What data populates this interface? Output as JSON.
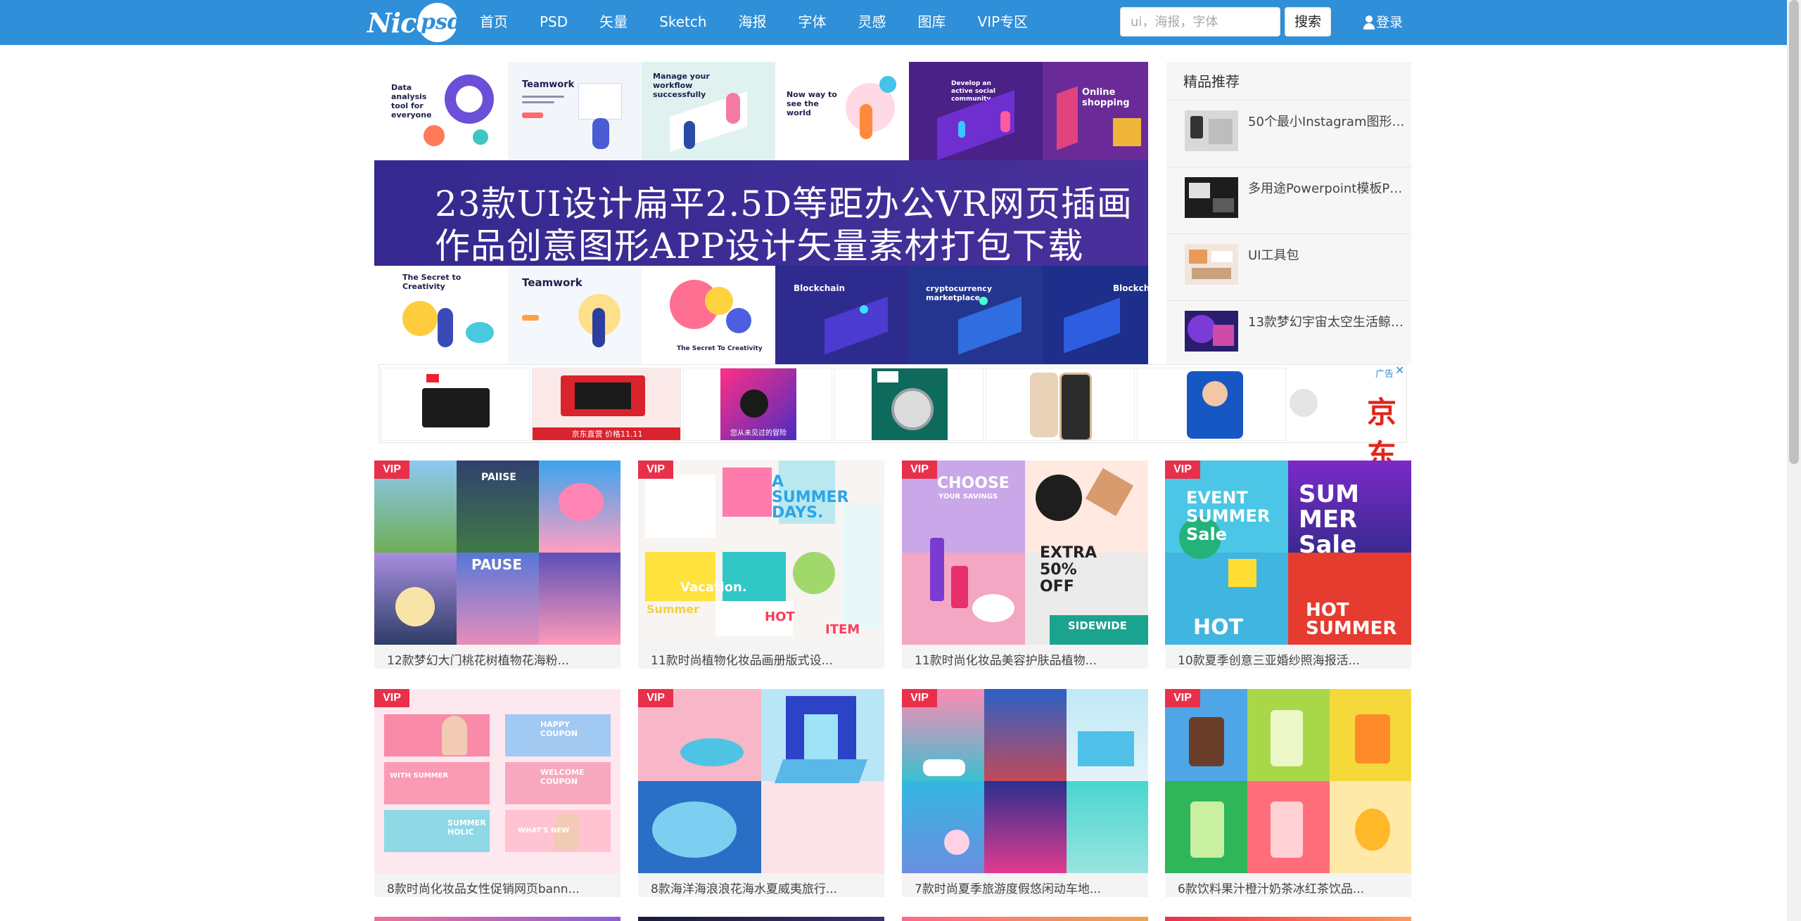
{
  "header": {
    "logo_nice": "Nice",
    "logo_psd": "psd",
    "nav": [
      "首页",
      "PSD",
      "矢量",
      "Sketch",
      "海报",
      "字体",
      "灵感",
      "图库",
      "VIP专区"
    ],
    "search_placeholder": "ui，海报，字体",
    "search_button": "搜索",
    "login": "登录"
  },
  "banner": {
    "line1": "23款UI设计扁平2.5D等距办公VR网页插画",
    "line2": "作品创意图形APP设计矢量素材打包下载",
    "tiles_top": [
      "Data analysis tool for everyone",
      "Teamwork",
      "Manage your workflow successfully",
      "Now way to see the world",
      "Develop an active social community",
      "Online shopping"
    ],
    "tiles_bottom": [
      "The Secret to Creativity",
      "Teamwork",
      "The Secret To Creativity",
      "Blockchain",
      "cryptocurrency marketplace",
      "Blockch"
    ]
  },
  "sidebar": {
    "title": "精品推荐",
    "items": [
      {
        "title": "50个最小Instagram图形，..."
      },
      {
        "title": "多用途Powerpoint模板PP..."
      },
      {
        "title": "UI工具包"
      },
      {
        "title": "13款梦幻宇宙太空生活鲸鱼..."
      }
    ]
  },
  "ad": {
    "badge": "广告",
    "close": "✕",
    "brand": "京东",
    "ad2_caption": "京东直营 价格11.11",
    "ad3_caption": "您从未见过的冒险"
  },
  "cards": [
    {
      "vip": "VIP",
      "title": "12款梦幻大门桃花树植物花海粉...",
      "texts": [
        "PAIISE",
        "PAUSE"
      ]
    },
    {
      "vip": "VIP",
      "title": "11款时尚植物化妆品画册版式设...",
      "texts": [
        "A SUMMER DAYS.",
        "Vacation.",
        "Summer",
        "HOT",
        "ITEM"
      ]
    },
    {
      "vip": "VIP",
      "title": "11款时尚化妆品美容护肤品植物...",
      "texts": [
        "CHOOSE",
        "YOUR SAVINGS",
        "EXTRA 50% OFF",
        "SIDEWIDE"
      ]
    },
    {
      "vip": "VIP",
      "title": "10款夏季创意三亚婚纱照海报活...",
      "texts": [
        "EVENT SUMMER Sale",
        "SUM MER Sale",
        "HOT",
        "HOT SUMMER"
      ]
    },
    {
      "vip": "VIP",
      "title": "8款时尚化妆品女性促销网页bann...",
      "texts": [
        "HAPPY COUPON",
        "WITH SUMMER",
        "WELCOME COUPON",
        "SUMMER HOLIC",
        "WHAT'S NEW"
      ]
    },
    {
      "vip": "VIP",
      "title": "8款海洋海浪浪花海水夏威夷旅行...",
      "texts": []
    },
    {
      "vip": "VIP",
      "title": "7款时尚夏季旅游度假悠闲动车地...",
      "texts": []
    },
    {
      "vip": "VIP",
      "title": "6款饮料果汁橙汁奶茶冰红茶饮品...",
      "texts": []
    }
  ],
  "colors": {
    "header": "#2f8fd8",
    "vip": "#e8304a",
    "banner_band": "#35288f",
    "jd_red": "#e1251b"
  }
}
